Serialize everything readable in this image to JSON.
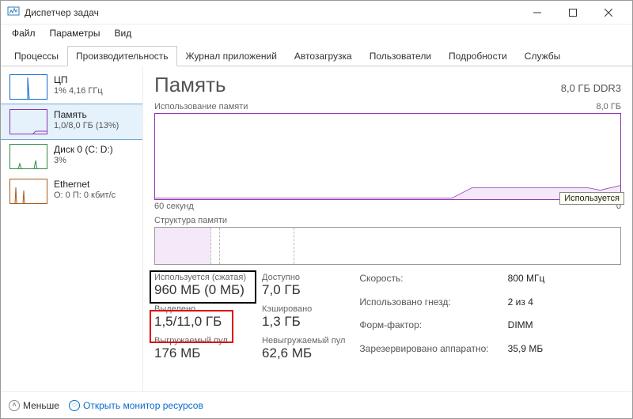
{
  "window": {
    "title": "Диспетчер задач",
    "menu": [
      "Файл",
      "Параметры",
      "Вид"
    ]
  },
  "tabs": {
    "items": [
      "Процессы",
      "Производительность",
      "Журнал приложений",
      "Автозагрузка",
      "Пользователи",
      "Подробности",
      "Службы"
    ],
    "active_index": 1
  },
  "sidebar": {
    "items": [
      {
        "title": "ЦП",
        "subtitle": "1% 4,16 ГГц",
        "kind": "cpu"
      },
      {
        "title": "Память",
        "subtitle": "1,0/8,0 ГБ (13%)",
        "kind": "mem",
        "selected": true
      },
      {
        "title": "Диск 0 (C: D:)",
        "subtitle": "3%",
        "kind": "disk"
      },
      {
        "title": "Ethernet",
        "subtitle": "О: 0 П: 0 кбит/с",
        "kind": "eth"
      }
    ]
  },
  "detail": {
    "title": "Память",
    "capacity": "8,0 ГБ DDR3",
    "usage_label": "Использование памяти",
    "usage_max": "8,0 ГБ",
    "usage_timespan": "60 секунд",
    "structure_label": "Структура памяти",
    "tooltip": "Используется"
  },
  "stats": {
    "in_use": {
      "label": "Используется (сжатая)",
      "value": "960 МБ (0 МБ)"
    },
    "available": {
      "label": "Доступно",
      "value": "7,0 ГБ"
    },
    "committed": {
      "label": "Выделено",
      "value": "1,5/11,0 ГБ"
    },
    "cached": {
      "label": "Кэшировано",
      "value": "1,3 ГБ"
    },
    "paged": {
      "label": "Выгружаемый пул",
      "value": "176 МБ"
    },
    "nonpaged": {
      "label": "Невыгружаемый пул",
      "value": "62,6 МБ"
    }
  },
  "specs": {
    "speed": {
      "label": "Скорость:",
      "value": "800 МГц"
    },
    "slots": {
      "label": "Использовано гнезд:",
      "value": "2 из 4"
    },
    "form": {
      "label": "Форм-фактор:",
      "value": "DIMM"
    },
    "reserved": {
      "label": "Зарезервировано аппаратно:",
      "value": "35,9 МБ"
    }
  },
  "footer": {
    "fewer": "Меньше",
    "resmon": "Открыть монитор ресурсов"
  },
  "chart_data": {
    "type": "line",
    "title": "Использование памяти",
    "xlabel": "60 секунд",
    "ylabel": "ГБ",
    "ylim": [
      0,
      8.0
    ],
    "x_seconds": [
      60,
      55,
      50,
      45,
      40,
      35,
      30,
      25,
      20,
      15,
      10,
      5,
      0
    ],
    "series": [
      {
        "name": "Используется",
        "values_gb": [
          0.05,
          0.05,
          0.05,
          0.05,
          0.05,
          0.05,
          0.05,
          0.5,
          1.0,
          1.0,
          1.0,
          1.0,
          1.0
        ]
      }
    ],
    "structure_segments": [
      {
        "name": "in_use",
        "fraction": 0.12
      },
      {
        "name": "modified",
        "fraction": 0.02
      },
      {
        "name": "standby",
        "fraction": 0.16
      },
      {
        "name": "free",
        "fraction": 0.7
      }
    ],
    "colors": {
      "memory": "#8e36b1"
    }
  }
}
